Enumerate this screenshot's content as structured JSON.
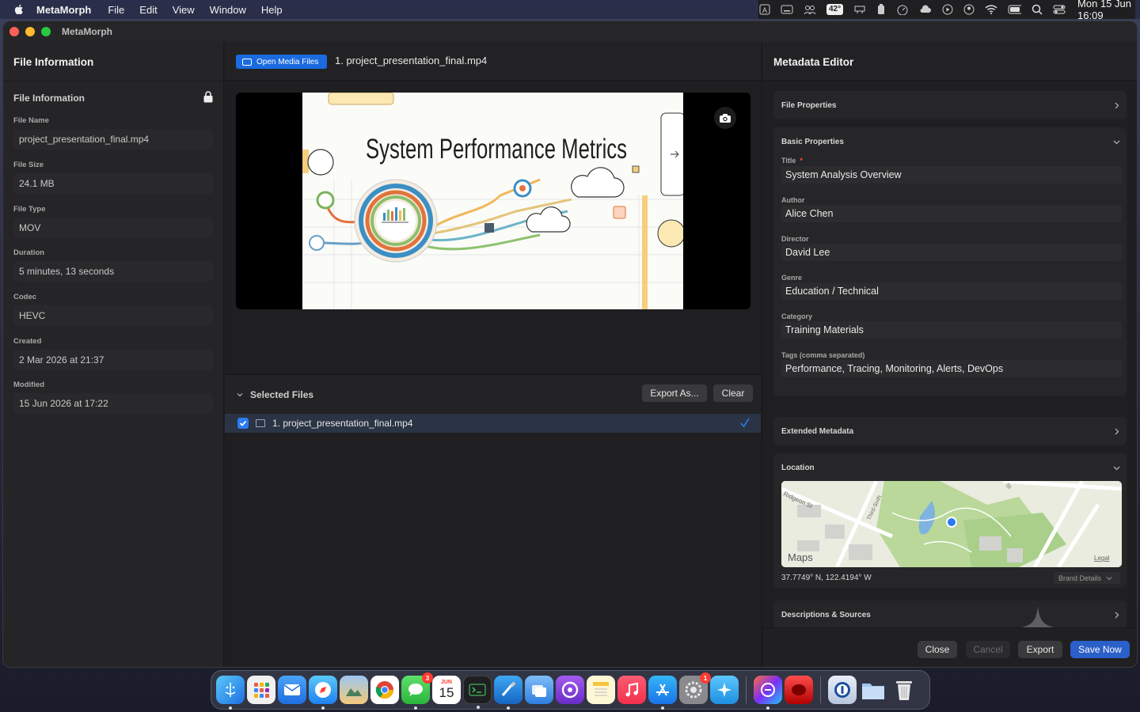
{
  "menubar": {
    "app_name": "MetaMorph",
    "menus": [
      "File",
      "Edit",
      "View",
      "Window",
      "Help"
    ],
    "temperature": "42°",
    "clock": "Mon 15 Jun  16:09"
  },
  "window": {
    "title": "MetaMorph"
  },
  "sidebar": {
    "title": "File Information",
    "section_title": "File Information",
    "fields": [
      {
        "label": "File Name",
        "value": "project_presentation_final.mp4"
      },
      {
        "label": "File Size",
        "value": "24.1 MB"
      },
      {
        "label": "File Type",
        "value": "MOV"
      },
      {
        "label": "Duration",
        "value": "5 minutes, 13 seconds"
      },
      {
        "label": "Codec",
        "value": "HEVC"
      },
      {
        "label": "Created",
        "value": "2 Mar 2026 at 21:37"
      },
      {
        "label": "Modified",
        "value": "15 Jun 2026 at 17:22"
      }
    ]
  },
  "middle": {
    "open_button": "Open Media Files",
    "file_title": "1. project_presentation_final.mp4",
    "slide_title": "System Performance Metrics",
    "selected_title": "Selected Files",
    "export_as": "Export As...",
    "clear": "Clear",
    "rows": [
      {
        "label": "1. project_presentation_final.mp4",
        "checked": true
      }
    ]
  },
  "right": {
    "title": "Metadata Editor",
    "file_properties": "File Properties",
    "basic_properties": "Basic Properties",
    "fields": [
      {
        "label": "Title",
        "value": "System Analysis Overview",
        "required": true
      },
      {
        "label": "Author",
        "value": "Alice Chen"
      },
      {
        "label": "Director",
        "value": "David Lee"
      },
      {
        "label": "Genre",
        "value": "Education / Technical"
      },
      {
        "label": "Category",
        "value": "Training Materials"
      },
      {
        "label": "Tags (comma separated)",
        "value": "Performance, Tracing, Monitoring, Alerts, DevOps"
      }
    ],
    "required_mark": "*",
    "extended_metadata": "Extended Metadata",
    "location": "Location",
    "map_brand": "Maps",
    "map_legal": "Legal",
    "map_streets": [
      "Ridgeon St",
      "Third-Sixth",
      "St"
    ],
    "coordinates": "37.7749° N, 122.4194° W",
    "brand_details": "Brand Details",
    "descriptions": "Descriptions & Sources",
    "buttons": {
      "close": "Close",
      "cancel": "Cancel",
      "export": "Export",
      "save": "Save Now"
    }
  },
  "dock": {
    "calendar_month": "JUN",
    "calendar_day": "15",
    "messages_badge": "3",
    "settings_badge": "1"
  },
  "colors": {
    "accent": "#1a6ae0",
    "save_button": "#2b5fc9",
    "required": "#ff453a"
  }
}
